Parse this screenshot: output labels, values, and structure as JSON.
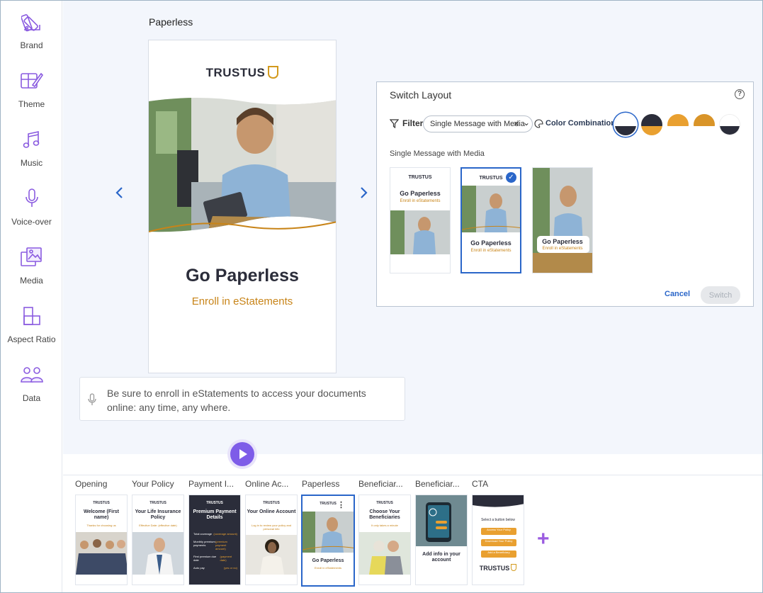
{
  "sidebar": {
    "items": [
      {
        "label": "Brand",
        "icon": "palette-icon"
      },
      {
        "label": "Theme",
        "icon": "theme-brush-icon"
      },
      {
        "label": "Music",
        "icon": "music-note-icon"
      },
      {
        "label": "Voice-over",
        "icon": "microphone-icon"
      },
      {
        "label": "Media",
        "icon": "media-images-icon"
      },
      {
        "label": "Aspect Ratio",
        "icon": "aspect-ratio-icon"
      },
      {
        "label": "Data",
        "icon": "users-data-icon"
      }
    ]
  },
  "scene": {
    "title": "Paperless",
    "preview": {
      "brand": "TRUSTUS",
      "headline": "Go Paperless",
      "subtext": "Enroll in eStatements"
    },
    "voiceover": "Be sure to enroll in eStatements to access your documents online: any time, any where."
  },
  "switch_layout": {
    "title": "Switch Layout",
    "filter_label": "Filter",
    "filter_chip": "Single Message with Media",
    "color_combinations_label": "Color Combinations",
    "section_label": "Single Message with Media",
    "layouts": [
      {
        "brand": "TRUSTUS",
        "headline": "Go Paperless",
        "subtext": "Enroll in eStatements"
      },
      {
        "brand": "TRUSTUS",
        "headline": "Go Paperless",
        "subtext": "Enroll in eStatements"
      },
      {
        "headline": "Go Paperless",
        "subtext": "Enroll in eStatements"
      }
    ],
    "cancel_label": "Cancel",
    "switch_label": "Switch",
    "colors": {
      "accent": "#2a66c9",
      "navy": "#2b2d3a",
      "gold": "#e9a030",
      "orange": "#d99428"
    }
  },
  "timeline": {
    "scenes": [
      {
        "name": "Opening",
        "brand": "TRUSTUS",
        "headline": "Welcome (First name)",
        "subtext": "Thanks for choosing us"
      },
      {
        "name": "Your Policy",
        "brand": "TRUSTUS",
        "headline": "Your Life Insurance Policy",
        "subtext": "Effective Date: (effective date)"
      },
      {
        "name": "Payment I...",
        "brand": "TRUSTUS",
        "headline": "Premium Payment Details",
        "subtext": ""
      },
      {
        "name": "Online Ac...",
        "brand": "TRUSTUS",
        "headline": "Your Online Account",
        "subtext": "Log in to review your policy and personal info"
      },
      {
        "name": "Paperless",
        "brand": "TRUSTUS",
        "headline": "Go Paperless",
        "subtext": "Enroll in eStatements"
      },
      {
        "name": "Beneficiar...",
        "brand": "TRUSTUS",
        "headline": "Choose Your Beneficiaries",
        "subtext": "It only takes a minute"
      },
      {
        "name": "Beneficiar...",
        "brand": "",
        "headline": "Add info in your account",
        "subtext": ""
      },
      {
        "name": "CTA",
        "brand": "TRUSTUS",
        "headline": "Select a button below",
        "subtext": ""
      }
    ],
    "payment_rows": [
      {
        "label": "Total coverage",
        "value": "(coverage amount)"
      },
      {
        "label": "Monthly premium payments",
        "value": "(premium payment amount)"
      },
      {
        "label": "First premium due date",
        "value": "(payment date)"
      },
      {
        "label": "Auto pay",
        "value": "(yes or no)"
      }
    ],
    "cta_buttons": [
      "Access Your Policy",
      "Download Your Policy",
      "Add a Beneficiary"
    ]
  }
}
